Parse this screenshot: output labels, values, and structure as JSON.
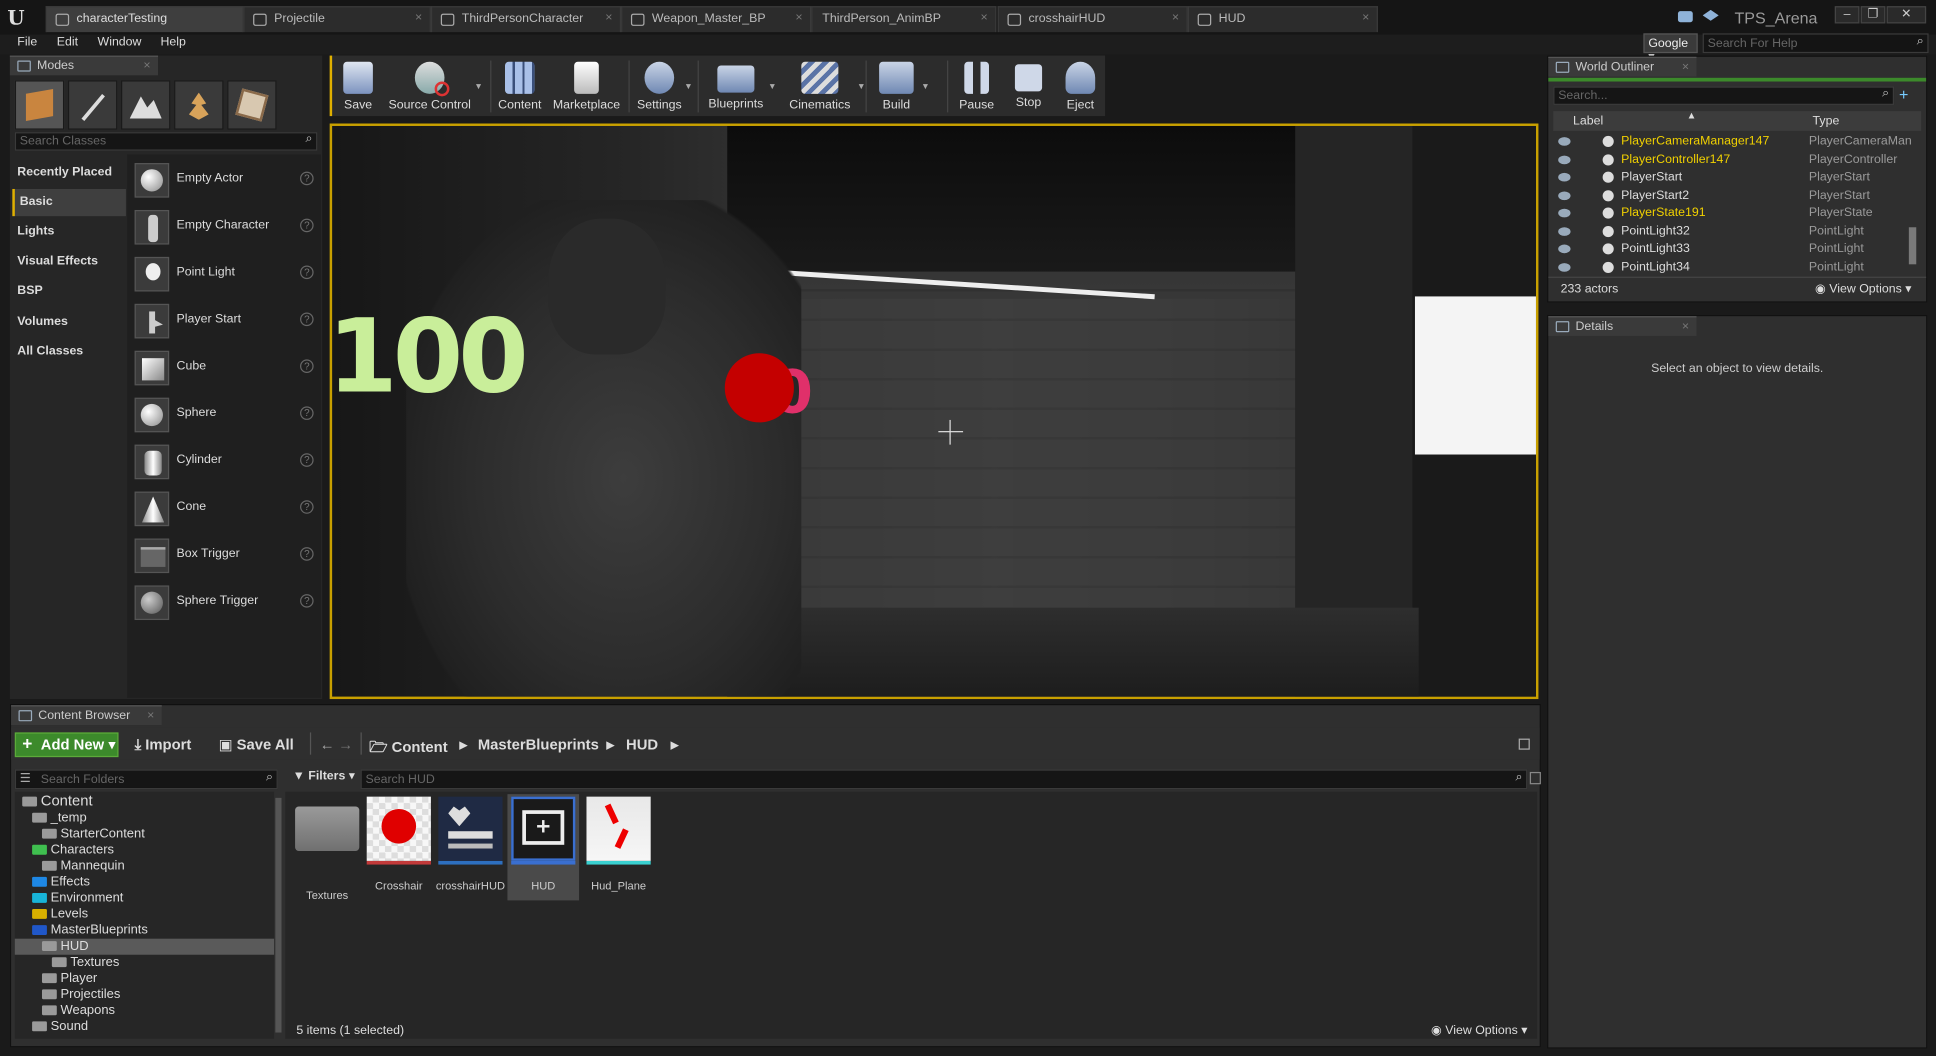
{
  "window": {
    "project_name": "TPS_Arena",
    "tabs": [
      "characterTesting",
      "Projectile",
      "ThirdPersonCharacter",
      "Weapon_Master_BP",
      "ThirdPerson_AnimBP",
      "crosshairHUD",
      "HUD"
    ]
  },
  "menu": [
    "File",
    "Edit",
    "Window",
    "Help"
  ],
  "help": {
    "provider": "Google",
    "search_placeholder": "Search For Help"
  },
  "modes": {
    "title": "Modes",
    "search_placeholder": "Search Classes",
    "categories": [
      "Recently Placed",
      "Basic",
      "Lights",
      "Visual Effects",
      "BSP",
      "Volumes",
      "All Classes"
    ],
    "active_category": "Basic",
    "items": [
      "Empty Actor",
      "Empty Character",
      "Point Light",
      "Player Start",
      "Cube",
      "Sphere",
      "Cylinder",
      "Cone",
      "Box Trigger",
      "Sphere Trigger"
    ]
  },
  "toolbar": {
    "buttons": [
      "Save",
      "Source Control",
      "Content",
      "Marketplace",
      "Settings",
      "Blueprints",
      "Cinematics",
      "Build",
      "Pause",
      "Stop",
      "Eject"
    ]
  },
  "viewport": {
    "ammo": "100",
    "hit_number": "0"
  },
  "outliner": {
    "title": "World Outliner",
    "search_placeholder": "Search...",
    "columns": {
      "label": "Label",
      "type": "Type"
    },
    "rows": [
      {
        "label": "PlayerCameraManager147",
        "type": "PlayerCameraMan",
        "color": "#f0d000"
      },
      {
        "label": "PlayerController147",
        "type": "PlayerController",
        "color": "#f0d000"
      },
      {
        "label": "PlayerStart",
        "type": "PlayerStart",
        "color": "#dddddd"
      },
      {
        "label": "PlayerStart2",
        "type": "PlayerStart",
        "color": "#dddddd"
      },
      {
        "label": "PlayerState191",
        "type": "PlayerState",
        "color": "#f0d000"
      },
      {
        "label": "PointLight32",
        "type": "PointLight",
        "color": "#dddddd"
      },
      {
        "label": "PointLight33",
        "type": "PointLight",
        "color": "#dddddd"
      },
      {
        "label": "PointLight34",
        "type": "PointLight",
        "color": "#dddddd"
      }
    ],
    "actor_count": "233 actors",
    "view_options": "View Options"
  },
  "details": {
    "title": "Details",
    "message": "Select an object to view details."
  },
  "content_browser": {
    "title": "Content Browser",
    "add_new": "Add New",
    "import": "Import",
    "save_all": "Save All",
    "breadcrumb": [
      "Content",
      "MasterBlueprints",
      "HUD"
    ],
    "folder_search_placeholder": "Search Folders",
    "filters": "Filters",
    "asset_search_placeholder": "Search HUD",
    "tree": [
      {
        "label": "Content",
        "depth": 0,
        "color": "#9a9a9a"
      },
      {
        "label": "_temp",
        "depth": 1,
        "color": "#9a9a9a"
      },
      {
        "label": "StarterContent",
        "depth": 2,
        "color": "#9a9a9a"
      },
      {
        "label": "Characters",
        "depth": 1,
        "color": "#3fbf4f"
      },
      {
        "label": "Mannequin",
        "depth": 2,
        "color": "#9a9a9a"
      },
      {
        "label": "Effects",
        "depth": 1,
        "color": "#1e88e5"
      },
      {
        "label": "Environment",
        "depth": 1,
        "color": "#18b4d8"
      },
      {
        "label": "Levels",
        "depth": 1,
        "color": "#d8b000"
      },
      {
        "label": "MasterBlueprints",
        "depth": 1,
        "color": "#2057c8"
      },
      {
        "label": "HUD",
        "depth": 2,
        "color": "#9a9a9a"
      },
      {
        "label": "Textures",
        "depth": 3,
        "color": "#9a9a9a"
      },
      {
        "label": "Player",
        "depth": 2,
        "color": "#9a9a9a"
      },
      {
        "label": "Projectiles",
        "depth": 2,
        "color": "#9a9a9a"
      },
      {
        "label": "Weapons",
        "depth": 2,
        "color": "#9a9a9a"
      },
      {
        "label": "Sound",
        "depth": 1,
        "color": "#9a9a9a"
      }
    ],
    "selected_folder": "HUD",
    "assets": [
      "Textures",
      "Crosshair",
      "crosshairHUD",
      "HUD",
      "Hud_Plane"
    ],
    "selected_asset": "HUD",
    "items_count": "5 items (1 selected)",
    "view_options": "View Options"
  },
  "colors": {
    "accent": "#e0b000",
    "add_new": "#3c8a2b",
    "selected_actor": "#f0d000"
  }
}
